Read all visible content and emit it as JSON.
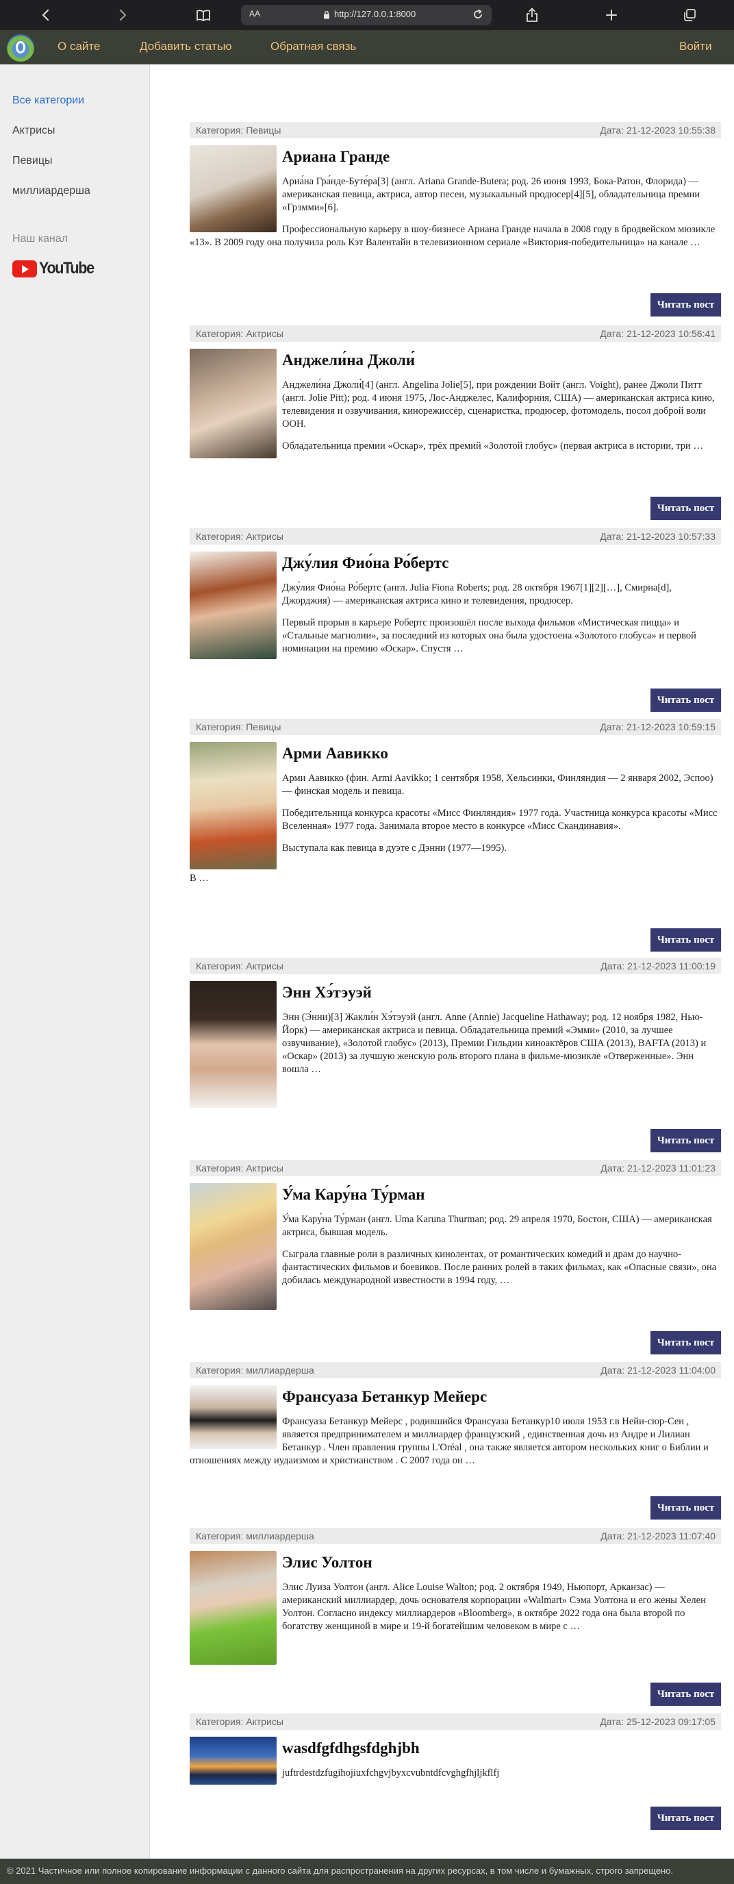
{
  "browser": {
    "text_size_label": "AA",
    "url": "http://127.0.0.1:8000"
  },
  "nav": {
    "about": "О сайте",
    "add_article": "Добавить статью",
    "feedback": "Обратная связь",
    "login": "Войти"
  },
  "sidebar": {
    "categories": [
      "Все категории",
      "Актрисы",
      "Певицы",
      "миллиардерша"
    ],
    "channel_label": "Наш канал",
    "youtube_label": "YouTube"
  },
  "read_more_label": "Читать пост",
  "posts": [
    {
      "category": "Категория: Певицы",
      "date": "Дата: 21-12-2023 10:55:38",
      "title": "Ариана Гранде",
      "paragraphs": [
        "Ариа́на Гра́нде-Буте́ра[3] (англ. Ariana Grande-Butera; род. 26 июня 1993, Бока-Ратон, Флорида) — американская певица, актриса, автор песен, музыкальный продюсер[4][5], обладательница премии «Грэмми»[6].",
        "Профессиональную карьеру в шоу-бизнесе Ариана Гранде начала в 2008 году в бродвейском мюзикле «13». В 2009 году она получила роль Кэт Валентайн в телевизионном сериале «Виктория-победительница» на канале …"
      ]
    },
    {
      "category": "Категория: Актрисы",
      "date": "Дата: 21-12-2023 10:56:41",
      "title": "Анджели́на Джоли́",
      "paragraphs": [
        "Анджели́на Джоли́[4] (англ. Angelina Jolie[5], при рождении Войт (англ. Voight), ранее Джоли Питт (англ. Jolie Pitt); род. 4 июня 1975, Лос-Анджелес, Калифорния, США) — американская актриса кино, телевидения и озвучивания, кинорежиссёр, сценаристка, продюсер, фотомодель, посол доброй воли ООН.",
        "Обладательница премии «Оскар», трёх премий «Золотой глобус» (первая актриса в истории, три …"
      ]
    },
    {
      "category": "Категория: Актрисы",
      "date": "Дата: 21-12-2023 10:57:33",
      "title": "Джу́лия Фио́на Ро́бертс",
      "paragraphs": [
        "Джу́лия Фио́на Ро́бертс (англ. Julia Fiona Roberts; род. 28 октября 1967[1][2][…], Смирна[d], Джорджия) — американская актриса кино и телевидения, продюсер.",
        "Первый прорыв в карьере Робертс произошёл после выхода фильмов «Мистическая пицца» и «Стальные магнолии», за последний из которых она была удостоена «Золотого глобуса» и первой номинации на премию «Оскар». Спустя …"
      ]
    },
    {
      "category": "Категория: Певицы",
      "date": "Дата: 21-12-2023 10:59:15",
      "title": "Арми Аавикко",
      "paragraphs": [
        "Арми Аавикко (фин. Armi Aavikko; 1 сентября 1958, Хельсинки, Финляндия — 2 января 2002, Эспоо) — финская модель и певица.",
        "Победительница конкурса красоты «Мисс Финляндия» 1977 года. Участница конкурса красоты «Мисс Вселенная» 1977 года. Занимала второе место в конкурсе «Мисс Скандинавия».",
        "Выступала как певица в дуэте с Дэнни (1977—1995).",
        "В …"
      ]
    },
    {
      "category": "Категория: Актрисы",
      "date": "Дата: 21-12-2023 11:00:19",
      "title": "Энн Хэ́тэуэй",
      "paragraphs": [
        "Энн (Э́нни)[3] Жакли́н Хэ́тэуэй (англ. Anne (Annie) Jacqueline Hathaway; род. 12 ноября 1982, Нью-Йорк) — американская актриса и певица. Обладательница премий «Эмми» (2010, за лучшее озвучивание), «Золотой глобус» (2013), Премии Гильдии киноактёров США (2013), BAFTA (2013) и «Оскар» (2013) за лучшую женскую роль второго плана в фильме-мюзикле «Отверженные». Энн вошла …"
      ]
    },
    {
      "category": "Категория: Актрисы",
      "date": "Дата: 21-12-2023 11:01:23",
      "title": "У́ма Кару́на Ту́рман",
      "paragraphs": [
        "У́ма Кару́на Ту́рман (англ. Uma Karuna Thurman; род. 29 апреля 1970, Бостон, США) — американская актриса, бывшая модель.",
        "Сыграла главные роли в различных кинолентах, от романтических комедий и драм до научно-фантастических фильмов и боевиков. После ранних ролей в таких фильмах, как «Опасные связи», она добилась международной известности в 1994 году, …"
      ]
    },
    {
      "category": "Категория: миллиардерша",
      "date": "Дата: 21-12-2023 11:04:00",
      "title": "Франсуаза Бетанкур Мейерс",
      "paragraphs": [
        "Франсуаза Бетанкур Мейерс , родившийся Франсуаза Бетанкур10 июля 1953 г.в Нейи-сюр-Сен , является предпринимателем и миллиардер французский , единственная дочь из Андре и Лилиан Бетанкур . Член правления группы L'Oréal , она также является автором нескольких книг о Библии и отношениях между иудаизмом и христианством . С 2007 года он …"
      ]
    },
    {
      "category": "Категория: миллиардерша",
      "date": "Дата: 21-12-2023 11:07:40",
      "title": "Элис Уолтон",
      "paragraphs": [
        "Элис Луиза Уолтон (англ. Alice Louise Walton; род. 2 октября 1949, Ньюпорт, Арканзас) — американский миллиардер, дочь основателя корпорации «Walmart» Сэма Уолтона и его жены Хелен Уолтон. Согласно индексу миллиардеров «Bloomberg», в октябре 2022 года она была второй по богатству женщиной в мире и 19-й богатейшим человеком в мире с …"
      ]
    },
    {
      "category": "Категория: Актрисы",
      "date": "Дата: 25-12-2023 09:17:05",
      "title": "wasdfgfdhgsfdghjbh",
      "paragraphs": [
        "juftrdestdzfugihojiuxfchgvjbyxcvubntdfcvghgfhjljkflfj"
      ]
    }
  ],
  "footer": "© 2021 Частичное или полное копирование информации с данного сайта для распространения на других ресурсах, в том числе и бумажных, строго запрещено."
}
